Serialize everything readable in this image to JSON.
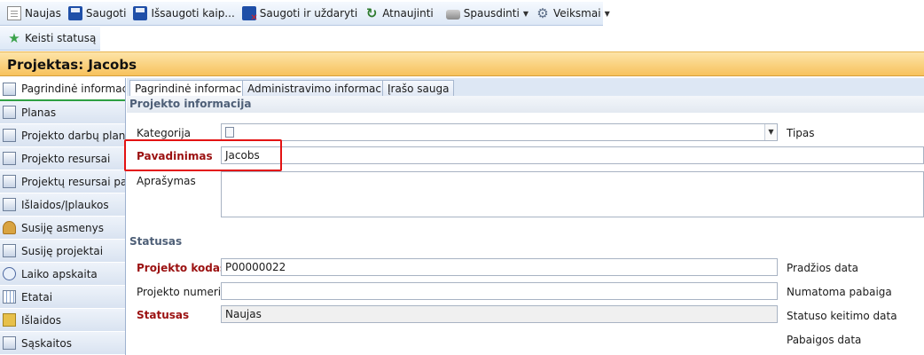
{
  "toolbar": {
    "new_label": "Naujas",
    "save_label": "Saugoti",
    "save_as_label": "Išsaugoti kaip...",
    "save_close_label": "Saugoti ir uždaryti",
    "refresh_label": "Atnaujinti",
    "print_label": "Spausdinti",
    "actions_label": "Veiksmai",
    "change_status_label": "Keisti statusą"
  },
  "record_title": "Projektas: Jacobs",
  "sidebar": {
    "items": [
      {
        "label": "Pagrindinė informacija",
        "icon": "form-icon",
        "active": true
      },
      {
        "label": "Planas",
        "icon": "form-icon"
      },
      {
        "label": "Projekto darbų planas",
        "icon": "form-icon"
      },
      {
        "label": "Projekto resursai",
        "icon": "form-icon"
      },
      {
        "label": "Projektų resursai pag...",
        "icon": "form-icon"
      },
      {
        "label": "Išlaidos/Įplaukos",
        "icon": "form-icon"
      },
      {
        "label": "Susiję asmenys",
        "icon": "person-icon"
      },
      {
        "label": "Susiję projektai",
        "icon": "form-icon"
      },
      {
        "label": "Laiko apskaita",
        "icon": "clock-icon"
      },
      {
        "label": "Etatai",
        "icon": "grid-icon"
      },
      {
        "label": "Išlaidos",
        "icon": "money-icon"
      },
      {
        "label": "Sąskaitos",
        "icon": "form-icon"
      }
    ]
  },
  "tabs": [
    "Pagrindinė informacija",
    "Administravimo informacija",
    "Įrašo sauga"
  ],
  "project_info": {
    "heading": "Projekto informacija",
    "category_label": "Kategorija",
    "category_value": "",
    "type_label": "Tipas",
    "name_label": "Pavadinimas",
    "name_value": "Jacobs",
    "description_label": "Aprašymas",
    "description_value": ""
  },
  "status": {
    "heading": "Statusas",
    "code_label": "Projekto kodas",
    "code_value": "P00000022",
    "number_label": "Projekto numeris",
    "number_value": "",
    "status_label": "Statusas",
    "status_value": "Naujas",
    "start_date_label": "Pradžios data",
    "planned_end_label": "Numatoma pabaiga",
    "status_change_date_label": "Statuso keitimo data",
    "end_date_label": "Pabaigos data"
  },
  "colors": {
    "title_bar": "#f7c25d",
    "required_label": "#9b1111",
    "highlight": "#e31212",
    "active_underline": "#2ea043"
  }
}
